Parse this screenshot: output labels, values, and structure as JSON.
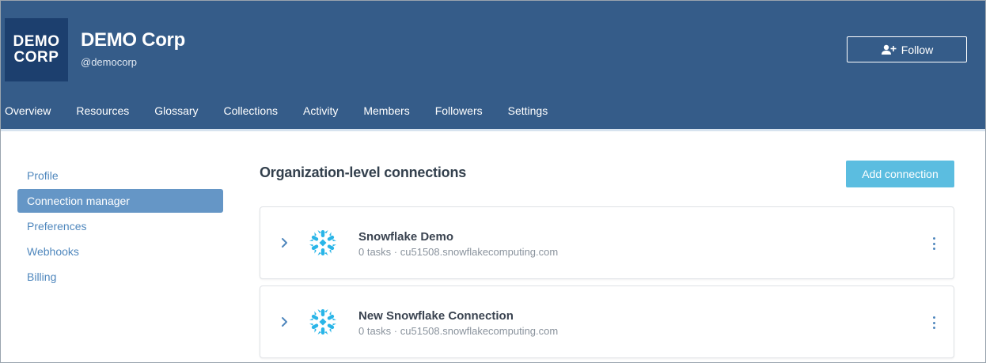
{
  "org": {
    "logo_line1": "DEMO",
    "logo_line2": "CORP",
    "name": "DEMO Corp",
    "handle": "@democorp",
    "follow_label": "Follow"
  },
  "nav": {
    "tabs": [
      "Overview",
      "Resources",
      "Glossary",
      "Collections",
      "Activity",
      "Members",
      "Followers",
      "Settings"
    ],
    "active": "Settings"
  },
  "sidebar": {
    "items": [
      "Profile",
      "Connection manager",
      "Preferences",
      "Webhooks",
      "Billing"
    ],
    "active": "Connection manager"
  },
  "main": {
    "title": "Organization-level connections",
    "add_label": "Add connection",
    "connections": [
      {
        "name": "Snowflake Demo",
        "tasks": "0 tasks",
        "host": "cu51508.snowflakecomputing.com"
      },
      {
        "name": "New Snowflake Connection",
        "tasks": "0 tasks",
        "host": "cu51508.snowflakecomputing.com"
      }
    ]
  },
  "colors": {
    "header_bg": "#355c89",
    "logo_bg": "#1c3f6e",
    "accent": "#5bbde0",
    "sidebar_active": "#6596c6",
    "snowflake": "#29b5e8"
  },
  "icons": {
    "follow": "add-person-icon",
    "expand": "chevron-right-icon",
    "connection": "snowflake-icon",
    "more": "kebab-menu-icon"
  }
}
